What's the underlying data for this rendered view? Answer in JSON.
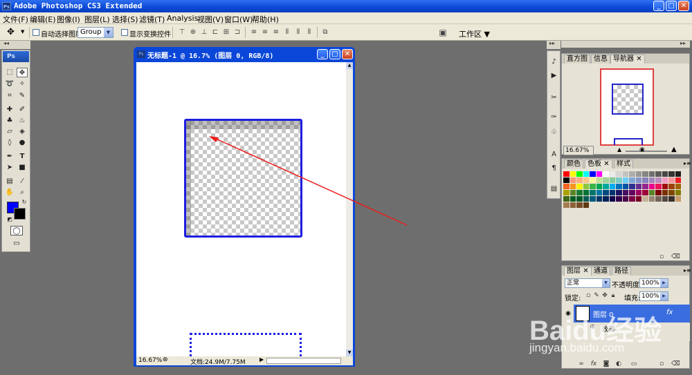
{
  "window": {
    "title": "Adobe Photoshop CS3 Extended",
    "badge": "Ps",
    "min_glyph": "_",
    "max_glyph": "□",
    "close_glyph": "✕"
  },
  "menu": [
    "文件(F)",
    "编辑(E)",
    "图像(I)",
    "图层(L)",
    "选择(S)",
    "滤镜(T)",
    "Analysis",
    "视图(V)",
    "窗口(W)",
    "帮助(H)"
  ],
  "options": {
    "auto_select_label": "自动选择图层",
    "auto_select_value": "Group",
    "show_transform_label": "显示变换控件",
    "workspace_label": "工作区"
  },
  "toolbox": {
    "ps_label": "Ps",
    "foreground_color": "#0000ff",
    "background_color": "#000000"
  },
  "document": {
    "title": "无标题-1 @ 16.7% (图层 0, RGB/8)",
    "zoom": "16.67%",
    "status": "文档:24.9M/7.75M"
  },
  "navigator": {
    "tabs": [
      "直方图",
      "信息",
      "导航器"
    ],
    "zoom": "16.67%"
  },
  "swatches": {
    "tabs": [
      "颜色",
      "色板",
      "样式"
    ],
    "colors": [
      "#ff0000",
      "#ffff00",
      "#00ff00",
      "#00ffff",
      "#0000ff",
      "#ff00ff",
      "#ffffff",
      "#ebebeb",
      "#d6d6d6",
      "#c2c2c2",
      "#adadad",
      "#999999",
      "#858585",
      "#707070",
      "#5c5c5c",
      "#474747",
      "#333333",
      "#1f1f1f",
      "#000000",
      "#f7977a",
      "#f9ad81",
      "#fdc68a",
      "#fff79a",
      "#c4df9b",
      "#a2d39c",
      "#82ca9d",
      "#7bcdc8",
      "#6ecff6",
      "#7ea7d8",
      "#8493ca",
      "#8882be",
      "#a187be",
      "#bc8dbf",
      "#f49ac2",
      "#f6989d",
      "#ed1c24",
      "#f26522",
      "#f7941d",
      "#fff200",
      "#8dc73f",
      "#39b54a",
      "#00a651",
      "#00a99d",
      "#00aeef",
      "#0072bc",
      "#0054a6",
      "#2e3192",
      "#662d91",
      "#92278f",
      "#ec008c",
      "#ed145b",
      "#9e0b0f",
      "#a0410d",
      "#a36209",
      "#aba000",
      "#598527",
      "#197b30",
      "#007236",
      "#00746b",
      "#0076a3",
      "#004a80",
      "#003471",
      "#1b1464",
      "#440e62",
      "#630460",
      "#9e005d",
      "#9e0039",
      "#598527",
      "#790000",
      "#7b2e00",
      "#7d4900",
      "#827b00",
      "#406618",
      "#005e20",
      "#005826",
      "#005952",
      "#005b7f",
      "#003663",
      "#002157",
      "#0d004c",
      "#32004b",
      "#4b0049",
      "#7b0046",
      "#7a0026",
      "#c7b299",
      "#998675",
      "#736357",
      "#534741",
      "#37302d",
      "#c69c6d",
      "#a67c52",
      "#8c6239",
      "#754c24",
      "#603913"
    ],
    "fx_label": "fx"
  },
  "layers": {
    "tabs": [
      "图层",
      "通道",
      "路径"
    ],
    "blend_mode": "正常",
    "opacity_label": "不透明度:",
    "opacity": "100%",
    "lock_label": "锁定:",
    "fill_label": "填充:",
    "fill": "100%",
    "layer_name": "图层 0",
    "effects_label": "效果",
    "fx_label": "fx"
  },
  "watermark": {
    "main": "Baidu经验",
    "sub": "jingyan.baidu.com"
  }
}
